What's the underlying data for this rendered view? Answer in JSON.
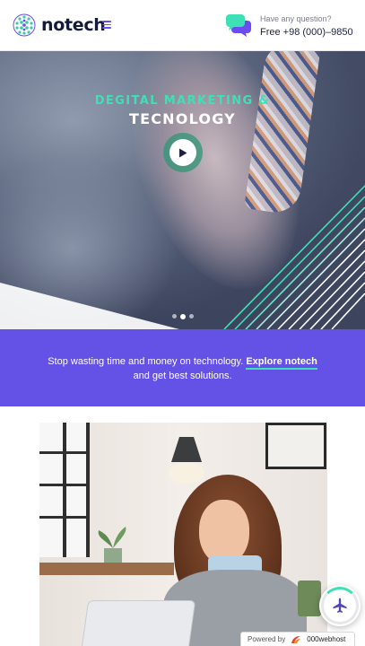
{
  "header": {
    "brand": "notech",
    "menu_icon": "hamburger-icon",
    "contact_label": "Have any question?",
    "contact_phone": "Free +98 (000)–9850",
    "chat_icon": "chat-bubbles-icon",
    "accent_color": "#6a4cf0"
  },
  "hero": {
    "subtitle": "DEGITAL MARKETING &",
    "title": "TECNOLOGY",
    "play_icon": "play-icon",
    "slides": 3,
    "active_slide": 2,
    "subtitle_color": "#3ee0b6"
  },
  "band": {
    "text_before": "Stop wasting time and money on technology.",
    "link_text": "Explore notech",
    "text_after": "and get best solutions.",
    "background": "#6451e6"
  },
  "photo": {
    "icon": "woman-at-laptop-photo"
  },
  "floating_button": {
    "icon": "airplane-icon"
  },
  "powered": {
    "label": "Powered by",
    "brand": "000webhost",
    "icon": "000webhost-logo-icon"
  }
}
